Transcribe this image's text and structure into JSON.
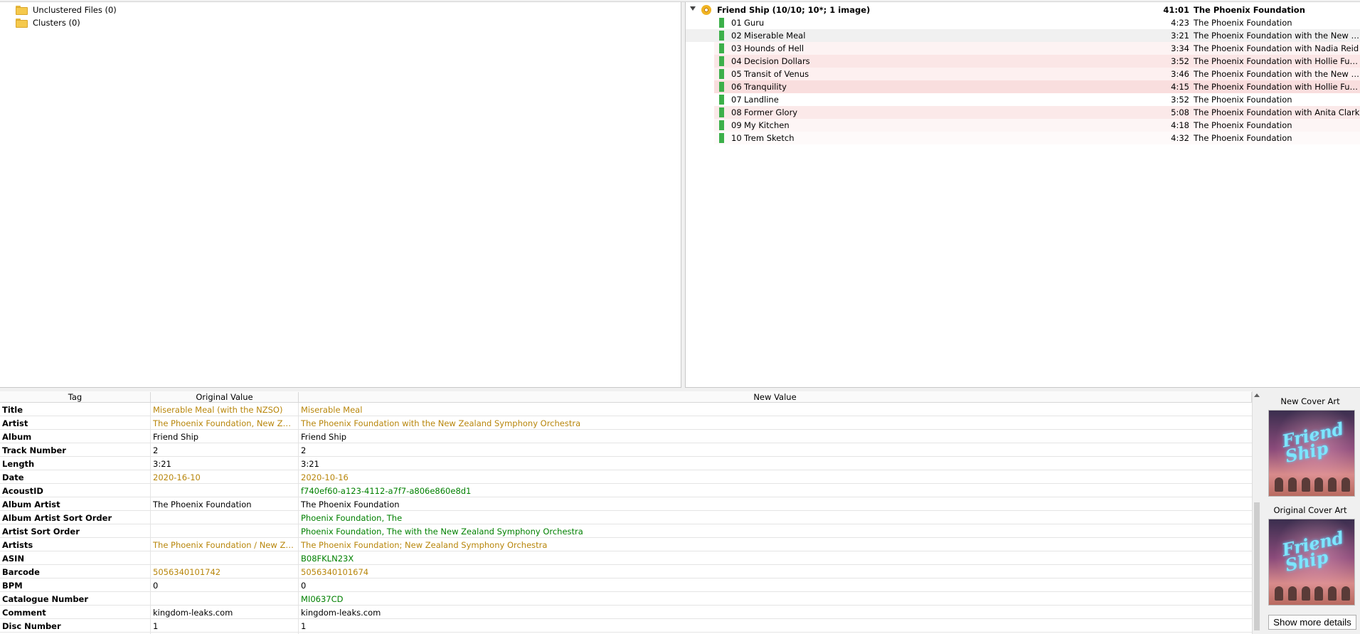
{
  "tree": [
    {
      "label": "Unclustered Files (0)"
    },
    {
      "label": "Clusters (0)"
    }
  ],
  "album": {
    "title": "Friend Ship (10/10; 10*; 1 image)",
    "length": "41:01",
    "artist": "The Phoenix Foundation",
    "tracks": [
      {
        "num": "01",
        "title": "Guru",
        "length": "4:23",
        "artist": "The Phoenix Foundation",
        "tint": ""
      },
      {
        "num": "02",
        "title": "Miserable Meal",
        "length": "3:21",
        "artist": "The Phoenix Foundation with the New Zeal...",
        "tint": "",
        "selected": true
      },
      {
        "num": "03",
        "title": "Hounds of Hell",
        "length": "3:34",
        "artist": "The Phoenix Foundation with Nadia Reid",
        "tint": "#fdf3f3"
      },
      {
        "num": "04",
        "title": "Decision Dollars",
        "length": "3:52",
        "artist": "The Phoenix Foundation with Hollie Fullbr...",
        "tint": "#fbe6e6"
      },
      {
        "num": "05",
        "title": "Transit of Venus",
        "length": "3:46",
        "artist": "The Phoenix Foundation with the New Zeal...",
        "tint": "#fdf0f0"
      },
      {
        "num": "06",
        "title": "Tranquility",
        "length": "4:15",
        "artist": "The Phoenix Foundation with Hollie Fullbr...",
        "tint": "#f9dede"
      },
      {
        "num": "07",
        "title": "Landline",
        "length": "3:52",
        "artist": "The Phoenix Foundation",
        "tint": ""
      },
      {
        "num": "08",
        "title": "Former Glory",
        "length": "5:08",
        "artist": "The Phoenix Foundation with Anita Clark",
        "tint": "#fbe9e9"
      },
      {
        "num": "09",
        "title": "My Kitchen",
        "length": "4:18",
        "artist": "The Phoenix Foundation",
        "tint": "#fdf5f5"
      },
      {
        "num": "10",
        "title": "Trem Sketch",
        "length": "4:32",
        "artist": "The Phoenix Foundation",
        "tint": "#fefafa"
      }
    ]
  },
  "metadata": {
    "headers": {
      "tag": "Tag",
      "original": "Original Value",
      "new": "New Value"
    },
    "rows": [
      {
        "tag": "Title",
        "original": "Miserable Meal (with the NZSO)",
        "new": "Miserable Meal",
        "state": "changed"
      },
      {
        "tag": "Artist",
        "original": "The Phoenix Foundation, New Zeala...",
        "new": "The Phoenix Foundation with the New Zealand Symphony Orchestra",
        "state": "changed"
      },
      {
        "tag": "Album",
        "original": "Friend Ship",
        "new": "Friend Ship",
        "state": "same"
      },
      {
        "tag": "Track Number",
        "original": "2",
        "new": "2",
        "state": "same"
      },
      {
        "tag": "Length",
        "original": "3:21",
        "new": "3:21",
        "state": "same"
      },
      {
        "tag": "Date",
        "original": "2020-16-10",
        "new": "2020-10-16",
        "state": "changed"
      },
      {
        "tag": "AcoustID",
        "original": "",
        "new": "f740ef60-a123-4112-a7f7-a806e860e8d1",
        "state": "added"
      },
      {
        "tag": "Album Artist",
        "original": "The Phoenix Foundation",
        "new": "The Phoenix Foundation",
        "state": "same"
      },
      {
        "tag": "Album Artist Sort Order",
        "original": "",
        "new": "Phoenix Foundation, The",
        "state": "added"
      },
      {
        "tag": "Artist Sort Order",
        "original": "",
        "new": "Phoenix Foundation, The with the New Zealand Symphony Orchestra",
        "state": "added"
      },
      {
        "tag": "Artists",
        "original": "The Phoenix Foundation / New Zeal...",
        "new": "The Phoenix Foundation; New Zealand Symphony Orchestra",
        "state": "changed"
      },
      {
        "tag": "ASIN",
        "original": "",
        "new": "B08FKLN23X",
        "state": "added"
      },
      {
        "tag": "Barcode",
        "original": "5056340101742",
        "new": "5056340101674",
        "state": "changed"
      },
      {
        "tag": "BPM",
        "original": "0",
        "new": "0",
        "state": "same"
      },
      {
        "tag": "Catalogue Number",
        "original": "",
        "new": "MI0637CD",
        "state": "added"
      },
      {
        "tag": "Comment",
        "original": "kingdom-leaks.com",
        "new": "kingdom-leaks.com",
        "state": "same"
      },
      {
        "tag": "Disc Number",
        "original": "1",
        "new": "1",
        "state": "same"
      }
    ]
  },
  "colors": {
    "changed": "#b8860b",
    "added": "#008000",
    "same": "#000000"
  },
  "cover": {
    "new_label": "New Cover Art",
    "original_label": "Original Cover Art",
    "art_text": "Friend Ship",
    "more_button": "Show more details"
  }
}
